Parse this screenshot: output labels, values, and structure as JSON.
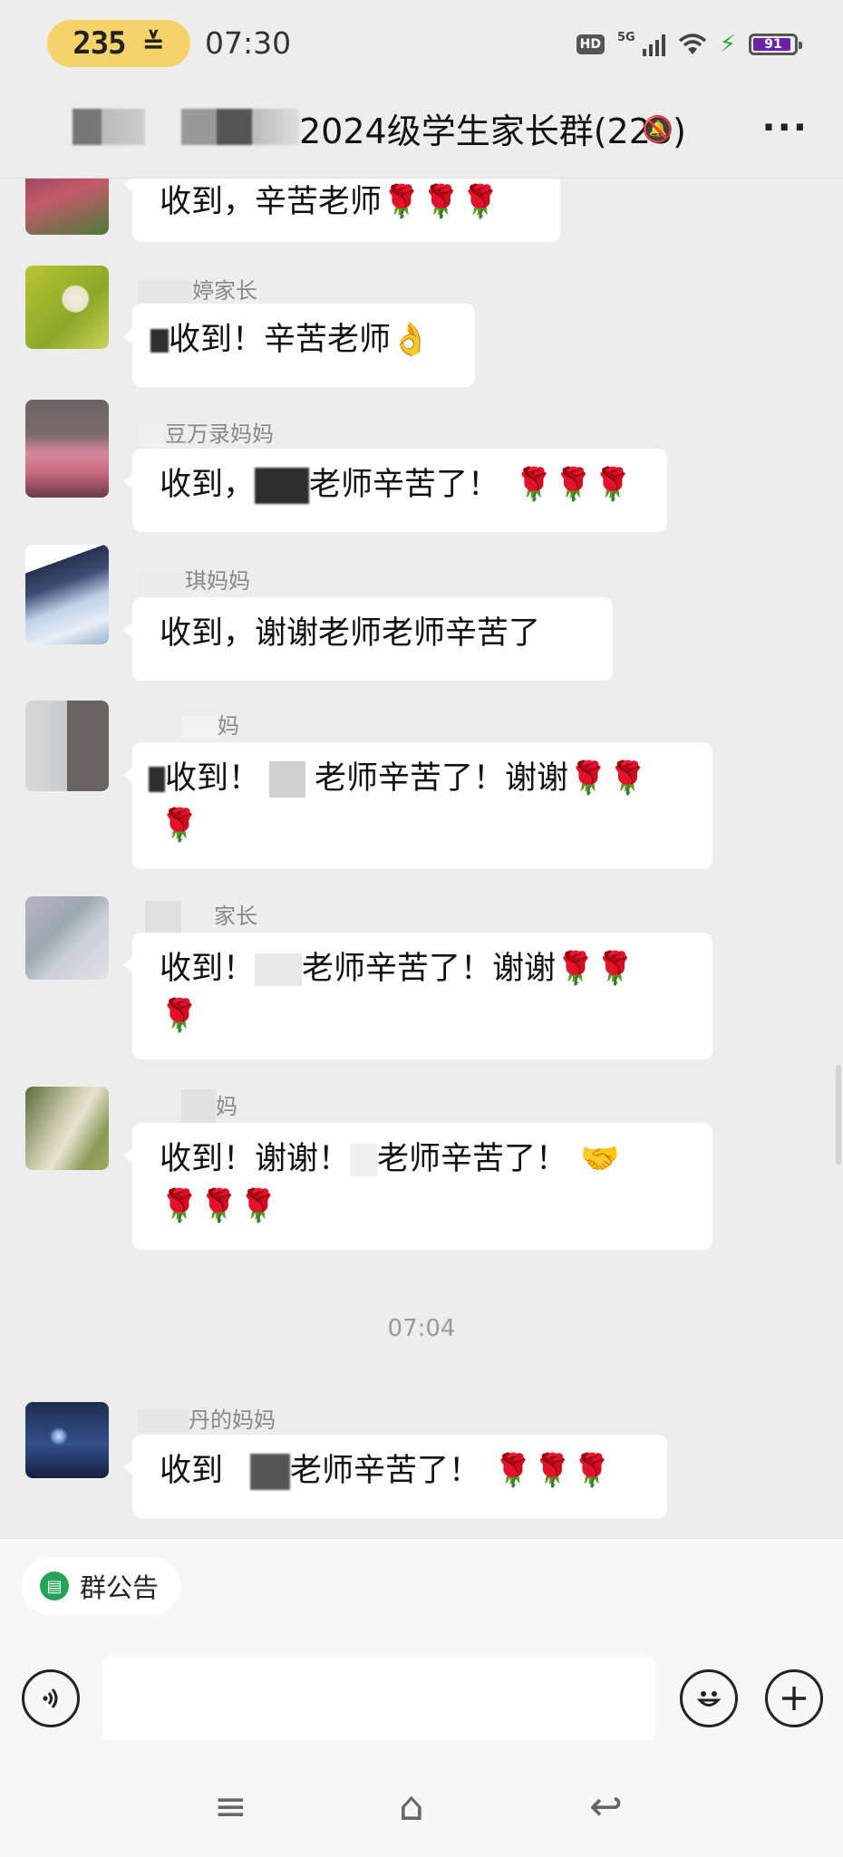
{
  "status_bar": {
    "pill_number": "235",
    "pill_icon": "≚",
    "time": "07:30",
    "hd": "HD",
    "network": "5G",
    "battery": "91"
  },
  "header": {
    "title": "2024级学生家长群(223)",
    "mute_icon": "🔕",
    "more_icon": "···"
  },
  "messages": [
    {
      "name": "",
      "prefix": "收到，辛苦老师",
      "roses": "🌹🌹🌹"
    },
    {
      "name": "婷家长",
      "text": "收到！辛苦老师",
      "emoji": "👌"
    },
    {
      "name": "豆万录妈妈",
      "prefix": "收到，",
      "suffix": "老师辛苦了！",
      "roses": "🌹🌹🌹"
    },
    {
      "name": "琪妈妈",
      "text": "收到，谢谢老师老师辛苦了"
    },
    {
      "name": "妈",
      "prefix": "收到！",
      "suffix": "老师辛苦了！谢谢",
      "roses": "🌹🌹",
      "roses2": "🌹"
    },
    {
      "name": "家长",
      "prefix": "收到！",
      "suffix": "老师辛苦了！谢谢",
      "roses": "🌹🌹",
      "roses2": "🌹"
    },
    {
      "name": "妈",
      "prefix": "收到！谢谢！",
      "suffix": "老师辛苦了！",
      "emoji": "🤝",
      "roses2": "🌹🌹🌹"
    },
    {
      "name": "丹的妈妈",
      "prefix": "收到",
      "suffix": "老师辛苦了！",
      "roses": "🌹🌹🌹"
    }
  ],
  "timestamp": "07:04",
  "bottom": {
    "notice_label": "群公告",
    "voice_icon": "voice-icon",
    "emoji_icon": "smile-icon",
    "plus_icon": "plus-icon",
    "nav_menu": "≡",
    "nav_home": "⌂",
    "nav_back": "↩"
  },
  "colors": {
    "rose": "#d8292d",
    "accent": "#25a35a",
    "battery": "#6b22a8"
  }
}
